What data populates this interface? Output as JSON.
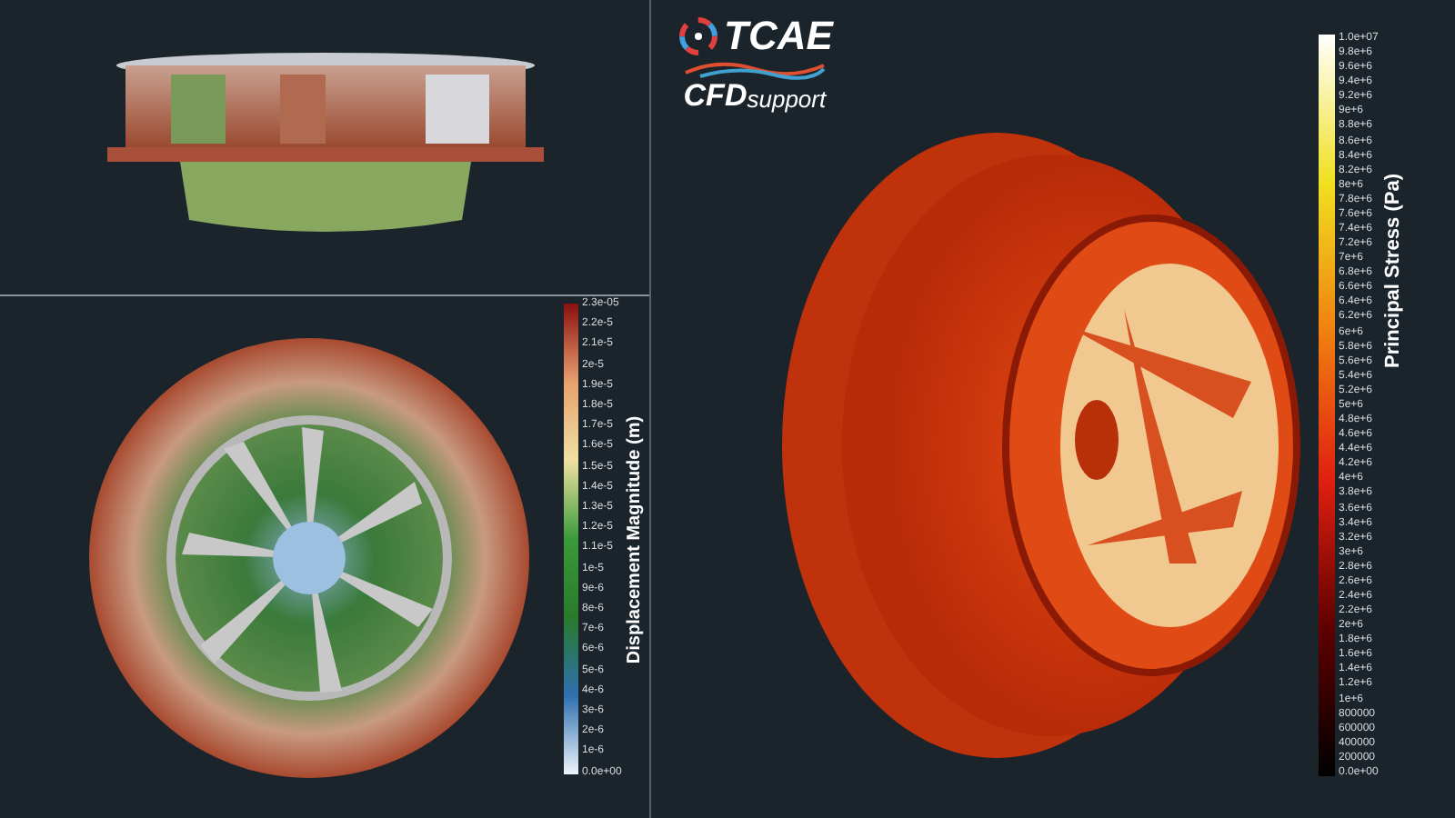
{
  "logo": {
    "name": "TCAE",
    "sub_bold": "CFD",
    "sub_light": "support"
  },
  "displacement_legend": {
    "title": "Displacement Magnitude (m)",
    "ticks": [
      "2.3e-05",
      "2.2e-5",
      "2.1e-5",
      "2e-5",
      "1.9e-5",
      "1.8e-5",
      "1.7e-5",
      "1.6e-5",
      "1.5e-5",
      "1.4e-5",
      "1.3e-5",
      "1.2e-5",
      "1.1e-5",
      "1e-5",
      "9e-6",
      "8e-6",
      "7e-6",
      "6e-6",
      "5e-6",
      "4e-6",
      "3e-6",
      "2e-6",
      "1e-6",
      "0.0e+00"
    ]
  },
  "stress_legend": {
    "title": "Principal Stress (Pa)",
    "ticks": [
      "1.0e+07",
      "9.8e+6",
      "9.6e+6",
      "9.4e+6",
      "9.2e+6",
      "9e+6",
      "8.8e+6",
      "8.6e+6",
      "8.4e+6",
      "8.2e+6",
      "8e+6",
      "7.8e+6",
      "7.6e+6",
      "7.4e+6",
      "7.2e+6",
      "7e+6",
      "6.8e+6",
      "6.6e+6",
      "6.4e+6",
      "6.2e+6",
      "6e+6",
      "5.8e+6",
      "5.6e+6",
      "5.4e+6",
      "5.2e+6",
      "5e+6",
      "4.8e+6",
      "4.6e+6",
      "4.4e+6",
      "4.2e+6",
      "4e+6",
      "3.8e+6",
      "3.6e+6",
      "3.4e+6",
      "3.2e+6",
      "3e+6",
      "2.8e+6",
      "2.6e+6",
      "2.4e+6",
      "2.2e+6",
      "2e+6",
      "1.8e+6",
      "1.6e+6",
      "1.4e+6",
      "1.2e+6",
      "1e+6",
      "800000",
      "600000",
      "400000",
      "200000",
      "0.0e+00"
    ]
  }
}
